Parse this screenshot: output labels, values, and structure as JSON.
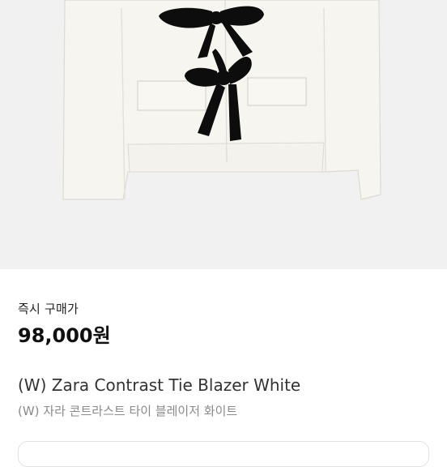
{
  "product": {
    "image_subject": "jacket-with-bows",
    "instant_buy_label": "즉시 구매가",
    "price": "98,000원",
    "title": "(W) Zara Contrast Tie Blazer White",
    "subtitle": "(W) 자라 콘트라스트 타이 블레이저 화이트"
  },
  "colors": {
    "background": "#ffffff",
    "image_background": "#f1f1f1",
    "jacket": "#f6f5f0",
    "bow": "#0d0d0d"
  }
}
